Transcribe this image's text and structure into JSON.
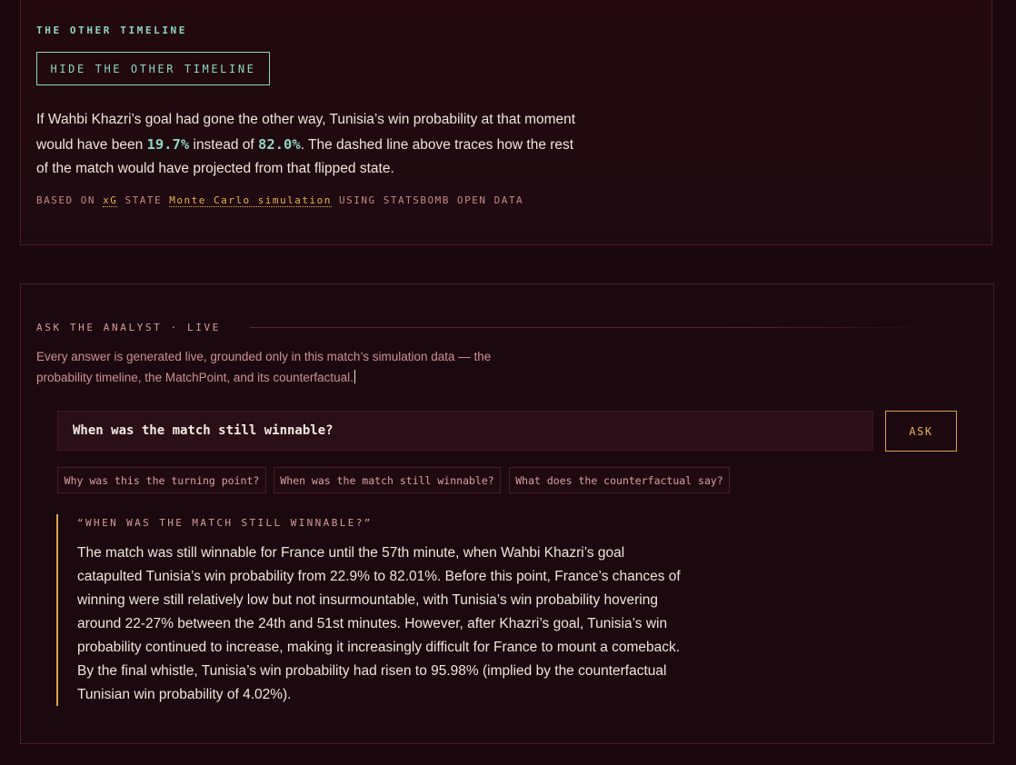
{
  "timeline": {
    "eyebrow": "THE OTHER TIMELINE",
    "hide_button": "HIDE THE OTHER TIMELINE",
    "text_before": "If Wahbi Khazri’s goal had gone the other way, Tunisia’s win probability at that moment would have been ",
    "flipped_prob": "19.7%",
    "text_middle": " instead of ",
    "actual_prob": "82.0%",
    "text_after": ". The dashed line above traces how the rest of the match would have projected from that flipped state.",
    "basis_prefix": "BASED ON ",
    "basis_xg": "xG",
    "basis_state": " STATE ",
    "basis_mc": "Monte Carlo simulation",
    "basis_suffix": " USING STATSBOMB OPEN DATA"
  },
  "analyst": {
    "eyebrow": "ASK THE ANALYST · LIVE",
    "intro": "Every answer is generated live, grounded only in this match’s simulation data — the probability timeline, the MatchPoint, and its counterfactual.",
    "input_value": "When was the match still winnable?",
    "ask_button": "ASK",
    "chips": [
      "Why was this the turning point?",
      "When was the match still winnable?",
      "What does the counterfactual say?"
    ],
    "answer_question": "“WHEN WAS THE MATCH STILL WINNABLE?”",
    "answer_text": "The match was still winnable for France until the 57th minute, when Wahbi Khazri’s goal catapulted Tunisia’s win probability from 22.9% to 82.01%. Before this point, France’s chances of winning were still relatively low but not insurmountable, with Tunisia’s win probability hovering around 22-27% between the 24th and 51st minutes. However, after Khazri’s goal, Tunisia’s win probability continued to increase, making it increasingly difficult for France to mount a comeback. By the final whistle, Tunisia’s win probability had risen to 95.98% (implied by the counterfactual Tunisian win probability of 4.02%)."
  },
  "colors": {
    "accent_teal": "#8fd6c4",
    "accent_gold": "#e8b04e",
    "muted_rose": "#cc8f94",
    "background": "#1a080e"
  }
}
